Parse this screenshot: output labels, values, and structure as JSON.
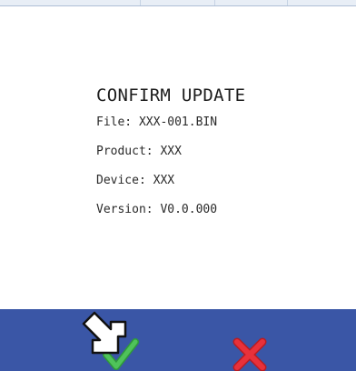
{
  "dialog": {
    "title": "CONFIRM UPDATE",
    "lines": [
      "File: XXX-001.BIN",
      "Product: XXX",
      "Device: XXX",
      "Version: V0.0.000"
    ]
  },
  "footer": {
    "confirm_icon": "check-icon",
    "cancel_icon": "close-icon"
  },
  "colors": {
    "footer_bg": "#3a56a6",
    "confirm": "#3fb24a",
    "cancel": "#e0262e"
  }
}
